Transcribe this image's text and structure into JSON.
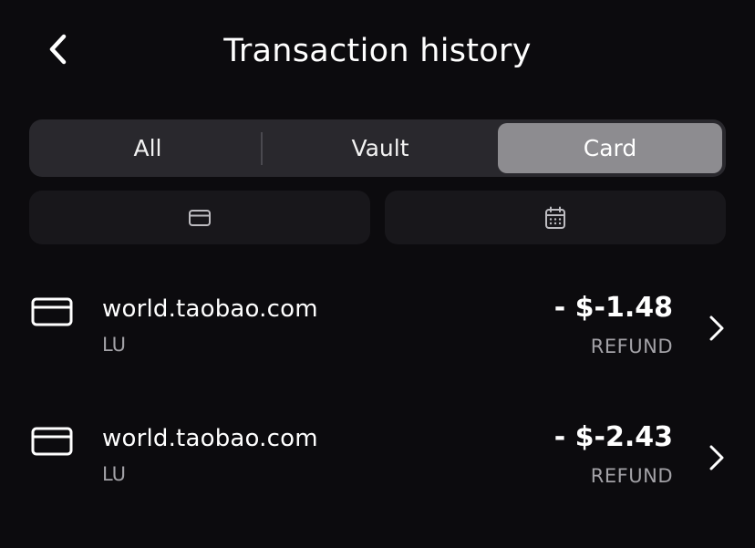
{
  "header": {
    "title": "Transaction history",
    "back_icon": "chevron-left-icon"
  },
  "tabs": [
    {
      "label": "All",
      "active": false
    },
    {
      "label": "Vault",
      "active": false
    },
    {
      "label": "Card",
      "active": true
    }
  ],
  "filters": {
    "card_icon": "credit-card-icon",
    "date_icon": "calendar-icon"
  },
  "transactions": [
    {
      "merchant": "world.taobao.com",
      "sub": "LU",
      "amount": "- $-1.48",
      "status": "REFUND",
      "icon": "credit-card-icon"
    },
    {
      "merchant": "world.taobao.com",
      "sub": "LU",
      "amount": "- $-2.43",
      "status": "REFUND",
      "icon": "credit-card-icon"
    }
  ],
  "colors": {
    "background": "#0c0b0e",
    "segment_track": "#29282d",
    "segment_active": "#8d8c90",
    "filter_bg": "#18171b",
    "muted_text": "#a3a2a7"
  }
}
